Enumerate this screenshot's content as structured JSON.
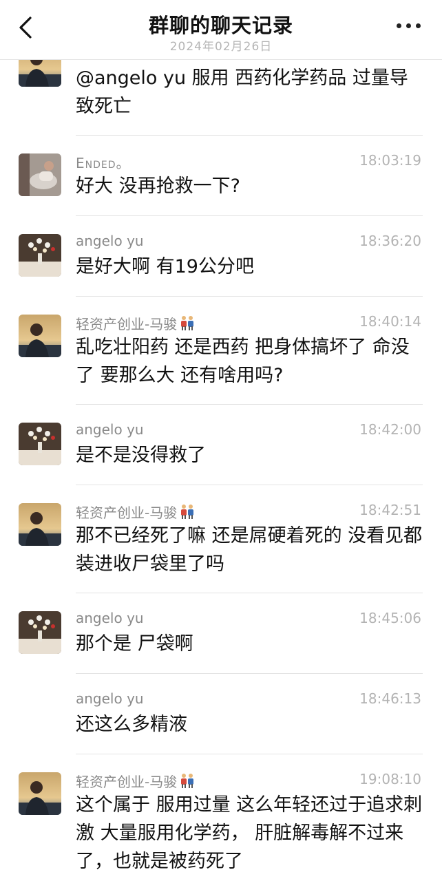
{
  "header": {
    "title": "群聊的聊天记录",
    "date": "2024年02月26日",
    "back_icon": "chevron-left-icon",
    "more_icon": "more-dots-icon"
  },
  "messages": [
    {
      "name": "",
      "time": "",
      "text": "@angelo yu  服用  西药化学药品  过量导致死亡",
      "avatar": "man-sunset-avatar"
    },
    {
      "name": "Ended。",
      "time": "18:03:19",
      "text": "好大    没再抢救一下?",
      "avatar": "photo-avatar"
    },
    {
      "name": "angelo yu",
      "time": "18:36:20",
      "text": "是好大啊 有19公分吧",
      "avatar": "flowers-avatar"
    },
    {
      "name": "轻资产创业-马骏",
      "time": "18:40:14",
      "text": "乱吃壮阳药 还是西药   把身体搞坏了  命没了    要那么大 还有啥用吗?",
      "avatar": "man-sunset-avatar"
    },
    {
      "name": "angelo yu",
      "time": "18:42:00",
      "text": "是不是没得救了",
      "avatar": "flowers-avatar"
    },
    {
      "name": "轻资产创业-马骏",
      "time": "18:42:51",
      "text": "那不已经死了嘛    还是屌硬着死的  没看见都装进收尸袋里了吗",
      "avatar": "man-sunset-avatar"
    },
    {
      "name": "angelo yu",
      "time": "18:45:06",
      "text": "那个是 尸袋啊",
      "avatar": "flowers-avatar"
    },
    {
      "name": "angelo yu",
      "time": "18:46:13",
      "text": "还这么多精液",
      "avatar": ""
    },
    {
      "name": "轻资产创业-马骏",
      "time": "19:08:10",
      "text": "这个属于 服用过量   这么年轻还过于追求刺激   大量服用化学药，  肝脏解毒解不过来了，也就是被药死了",
      "avatar": "man-sunset-avatar"
    }
  ],
  "colors": {
    "name": "#8a8a8a",
    "time": "#b3b3b3",
    "divider": "#e3e3e3"
  }
}
